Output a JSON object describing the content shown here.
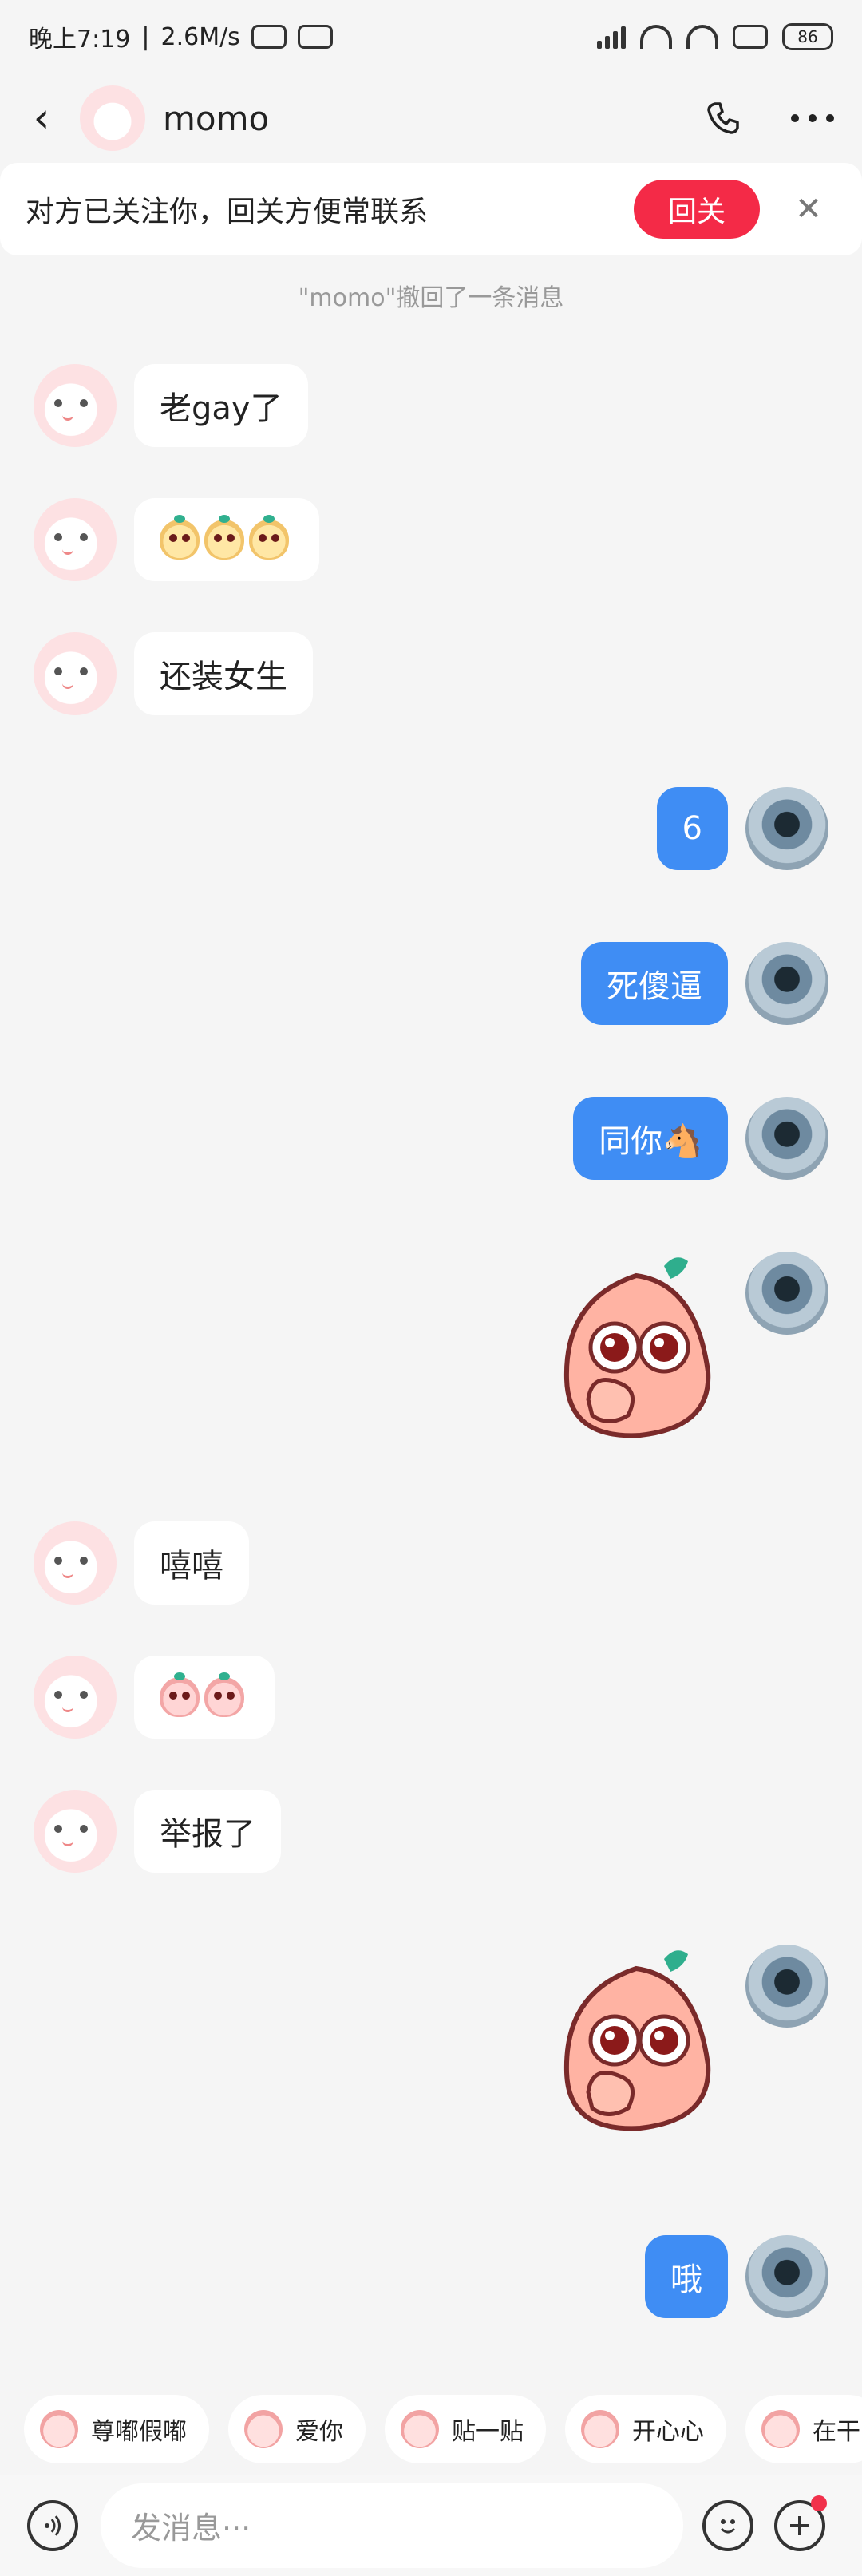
{
  "status_bar": {
    "time": "晚上7:19",
    "speed": "2.6M/s",
    "battery": "86"
  },
  "header": {
    "title": "momo"
  },
  "follow_banner": {
    "text": "对方已关注你，回关方便常联系",
    "button": "回关"
  },
  "system_note": "\"momo\"撤回了一条消息",
  "messages": [
    {
      "side": "in",
      "text": "老gay了"
    },
    {
      "side": "in",
      "type": "emoji",
      "count": 3
    },
    {
      "side": "in",
      "text": "还装女生"
    },
    {
      "side": "out",
      "text": "6"
    },
    {
      "side": "out",
      "text": "死傻逼"
    },
    {
      "side": "out",
      "text": "同你🐴"
    },
    {
      "side": "out",
      "type": "sticker"
    },
    {
      "side": "in",
      "text": "嘻嘻"
    },
    {
      "side": "in",
      "type": "emoji",
      "count": 2
    },
    {
      "side": "in",
      "text": "举报了"
    },
    {
      "side": "out",
      "type": "sticker"
    },
    {
      "side": "out",
      "text": "哦"
    }
  ],
  "quick_replies": [
    "尊嘟假嘟",
    "爱你",
    "贴一贴",
    "开心心",
    "在干"
  ],
  "input": {
    "placeholder": "发消息···"
  },
  "colors": {
    "accent_blue": "#3f8df4",
    "follow_red": "#f42a47"
  }
}
